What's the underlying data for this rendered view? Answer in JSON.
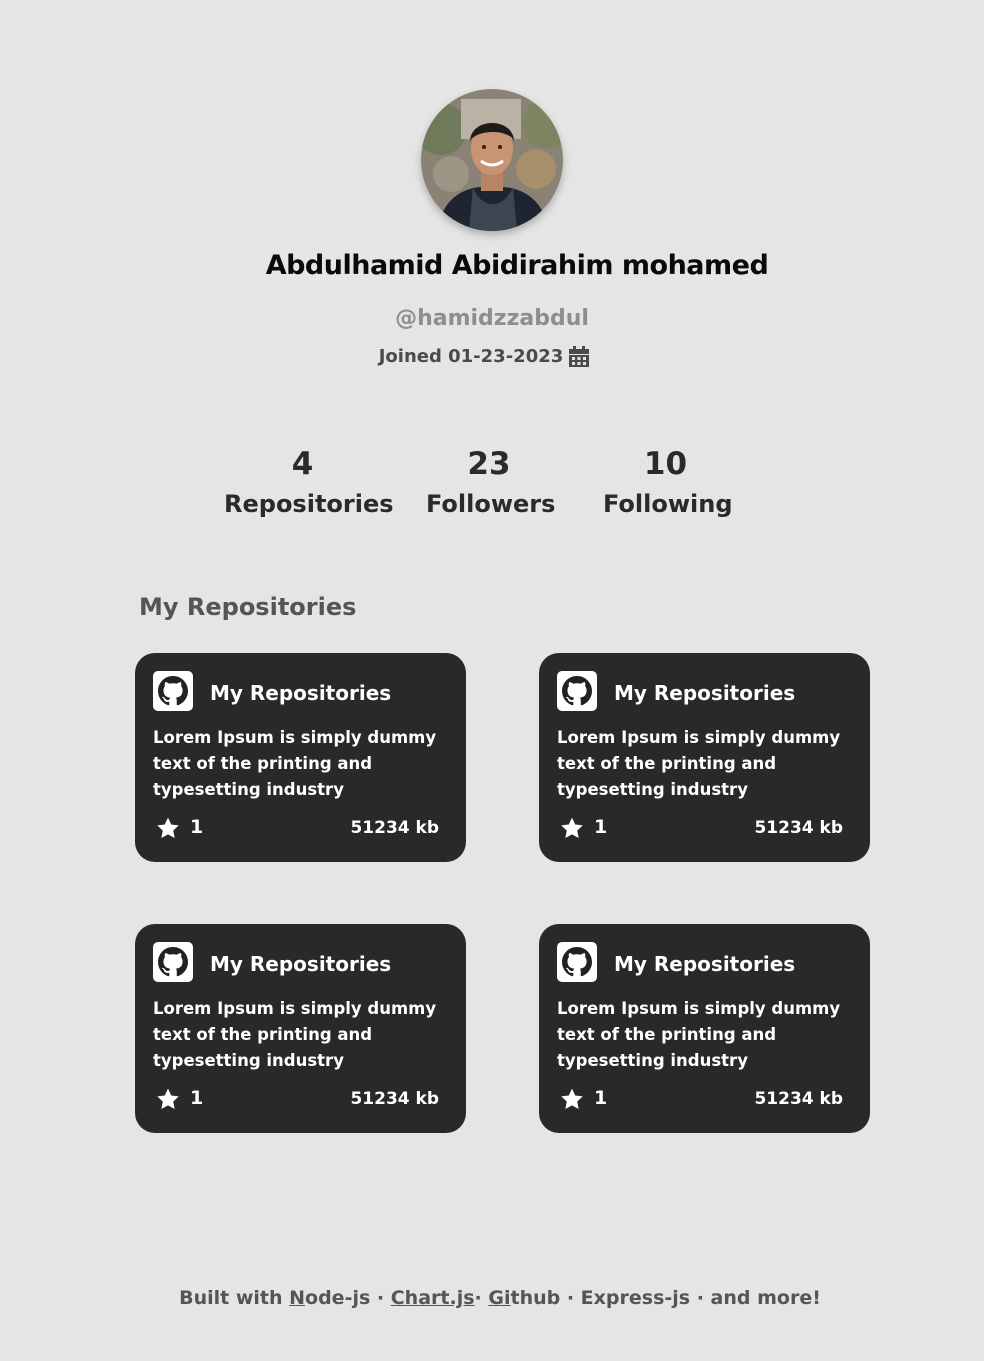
{
  "profile": {
    "name": "Abdulhamid Abidirahim mohamed",
    "handle": "@hamidzzabdul",
    "joined": "Joined 01-23-2023"
  },
  "stats": [
    {
      "value": "4",
      "label": "Repositories"
    },
    {
      "value": "23",
      "label": "Followers"
    },
    {
      "value": "10",
      "label": "Following"
    }
  ],
  "section_title": "My Repositories",
  "repos": [
    {
      "title": "My Repositories",
      "description": "Lorem Ipsum is simply dummy text of the printing and typesetting industry",
      "stars": "1",
      "size": "51234 kb"
    },
    {
      "title": "My Repositories",
      "description": "Lorem Ipsum is simply dummy text of the printing and typesetting industry",
      "stars": "1",
      "size": "51234 kb"
    },
    {
      "title": "My Repositories",
      "description": "Lorem Ipsum is simply dummy text of the printing and typesetting industry",
      "stars": "1",
      "size": "51234 kb"
    },
    {
      "title": "My Repositories",
      "description": "Lorem Ipsum is simply dummy text of the printing and typesetting industry",
      "stars": "1",
      "size": "51234 kb"
    }
  ],
  "footer": {
    "prefix": "Built with ",
    "node_first": "N",
    "node_rest": "ode-js",
    "sep1": " · ",
    "chart": "Chart.js",
    "sep2": "· ",
    "github_first": "Gi",
    "github_rest": "thub",
    "rest": " · Express-js · and more!"
  },
  "colors": {
    "background": "#e5e5e5",
    "card": "#292929",
    "text_dark": "#2a2a2a",
    "text_muted": "#8e8e8e"
  },
  "icons": [
    "calendar-icon",
    "github-icon",
    "star-icon"
  ]
}
